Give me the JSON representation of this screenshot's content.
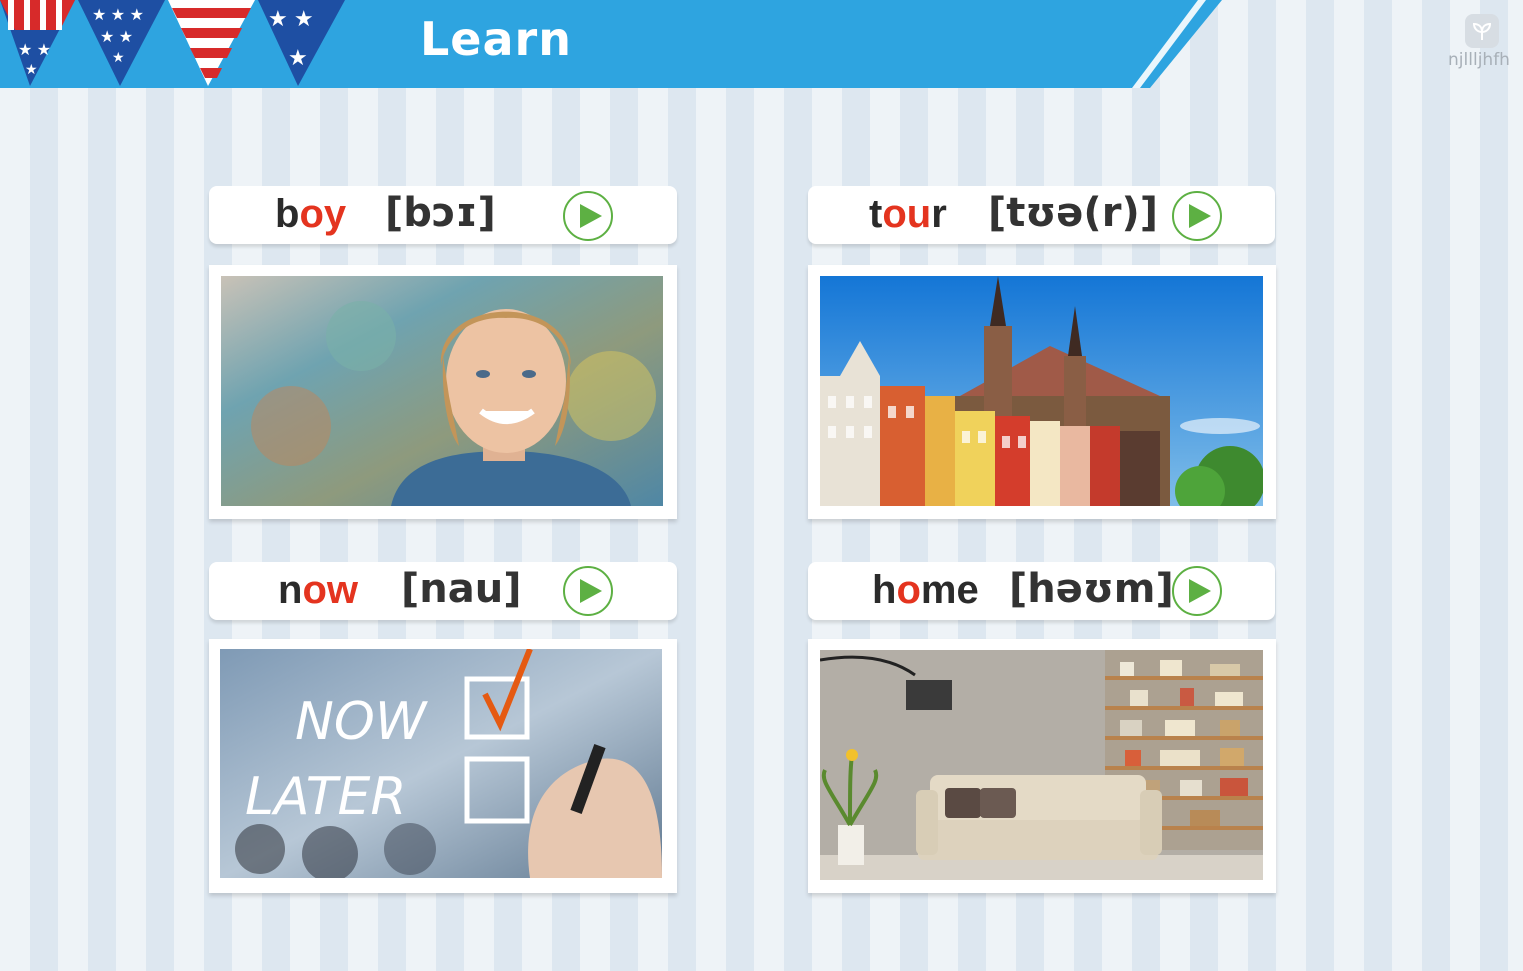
{
  "header": {
    "title": "Learn",
    "banner_color": "#2ea4e0"
  },
  "watermark": {
    "text": "njllljhfh"
  },
  "accent_colors": {
    "highlight": "#e4341f",
    "play": "#5db043"
  },
  "cards": [
    {
      "word_parts": [
        "b",
        "oy",
        ""
      ],
      "phonetic": "[bɔɪ]",
      "image": "boy-photo",
      "play_icon": "play-icon"
    },
    {
      "word_parts": [
        "t",
        "ou",
        "r"
      ],
      "phonetic": "[tʊə(r)]",
      "image": "tour-photo",
      "play_icon": "play-icon"
    },
    {
      "word_parts": [
        "n",
        "ow",
        ""
      ],
      "phonetic": "[nau]",
      "image": "now-photo",
      "image_text": [
        "NOW",
        "LATER"
      ],
      "play_icon": "play-icon"
    },
    {
      "word_parts": [
        "h",
        "o",
        "me"
      ],
      "phonetic": "[həʊm]",
      "image": "home-photo",
      "play_icon": "play-icon"
    }
  ]
}
